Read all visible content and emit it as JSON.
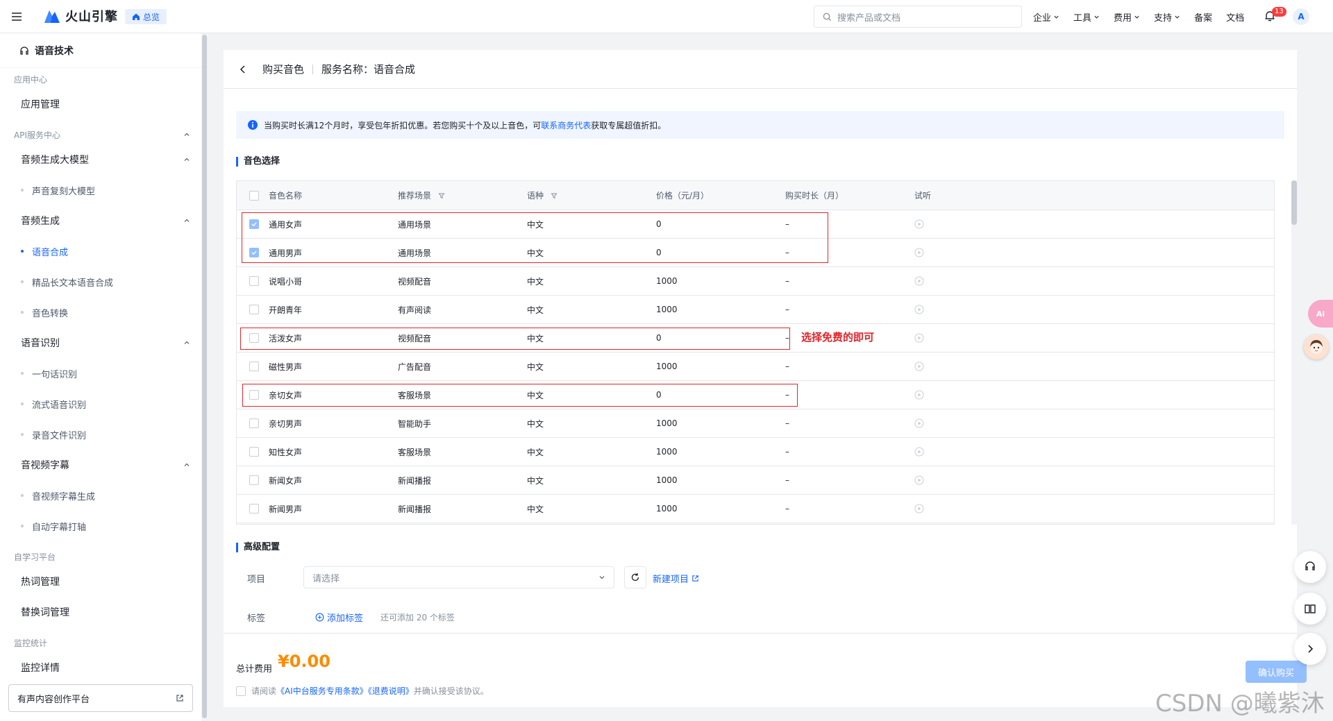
{
  "topbar": {
    "brand": "火山引擎",
    "overview": "总览",
    "search_placeholder": "搜索产品或文档",
    "nav": [
      "企业",
      "工具",
      "费用",
      "支持",
      "备案",
      "文档"
    ],
    "notification_count": "13",
    "avatar_letter": "A"
  },
  "sidebar": {
    "title": "语音技术",
    "items": [
      {
        "kind": "group",
        "label": "应用中心"
      },
      {
        "kind": "sub",
        "label": "应用管理"
      },
      {
        "kind": "group",
        "label": "API服务中心"
      },
      {
        "kind": "sub",
        "label": "音频生成大模型"
      },
      {
        "kind": "leaf",
        "label": "声音复刻大模型"
      },
      {
        "kind": "sub",
        "label": "音频生成"
      },
      {
        "kind": "leaf",
        "label": "语音合成",
        "active": true
      },
      {
        "kind": "leaf",
        "label": "精品长文本语音合成"
      },
      {
        "kind": "leaf",
        "label": "音色转换"
      },
      {
        "kind": "sub",
        "label": "语音识别"
      },
      {
        "kind": "leaf",
        "label": "一句话识别"
      },
      {
        "kind": "leaf",
        "label": "流式语音识别"
      },
      {
        "kind": "leaf",
        "label": "录音文件识别"
      },
      {
        "kind": "sub",
        "label": "音视频字幕"
      },
      {
        "kind": "leaf",
        "label": "音视频字幕生成"
      },
      {
        "kind": "leaf",
        "label": "自动字幕打轴"
      },
      {
        "kind": "group",
        "label": "自学习平台"
      },
      {
        "kind": "sub",
        "label": "热词管理"
      },
      {
        "kind": "sub",
        "label": "替换词管理"
      },
      {
        "kind": "group",
        "label": "监控统计"
      },
      {
        "kind": "sub",
        "label": "监控详情"
      }
    ],
    "bottom_link": "有声内容创作平台"
  },
  "page": {
    "title": "购买音色",
    "service_label": "服务名称：语音合成",
    "notice_prefix": "当购买时长满12个月时，享受包年折扣优惠。若您购买十个及以上音色，可",
    "notice_link": "联系商务代表",
    "notice_suffix": "获取专属超值折扣。",
    "section_voice": "音色选择",
    "section_advanced": "高级配置"
  },
  "table": {
    "headers": [
      "音色名称",
      "推荐场景",
      "语种",
      "价格（元/月）",
      "购买时长（月）",
      "试听"
    ],
    "rows": [
      {
        "name": "通用女声",
        "scene": "通用场景",
        "lang": "中文",
        "price": "0",
        "duration": "–",
        "checked": true
      },
      {
        "name": "通用男声",
        "scene": "通用场景",
        "lang": "中文",
        "price": "0",
        "duration": "–",
        "checked": true
      },
      {
        "name": "说唱小哥",
        "scene": "视频配音",
        "lang": "中文",
        "price": "1000",
        "duration": "–",
        "checked": false
      },
      {
        "name": "开朗青年",
        "scene": "有声阅读",
        "lang": "中文",
        "price": "1000",
        "duration": "–",
        "checked": false
      },
      {
        "name": "活泼女声",
        "scene": "视频配音",
        "lang": "中文",
        "price": "0",
        "duration": "–",
        "checked": false
      },
      {
        "name": "磁性男声",
        "scene": "广告配音",
        "lang": "中文",
        "price": "1000",
        "duration": "–",
        "checked": false
      },
      {
        "name": "亲切女声",
        "scene": "客服场景",
        "lang": "中文",
        "price": "0",
        "duration": "–",
        "checked": false
      },
      {
        "name": "亲切男声",
        "scene": "智能助手",
        "lang": "中文",
        "price": "1000",
        "duration": "–",
        "checked": false
      },
      {
        "name": "知性女声",
        "scene": "客服场景",
        "lang": "中文",
        "price": "1000",
        "duration": "–",
        "checked": false
      },
      {
        "name": "新闻女声",
        "scene": "新闻播报",
        "lang": "中文",
        "price": "1000",
        "duration": "–",
        "checked": false
      },
      {
        "name": "新闻男声",
        "scene": "新闻播报",
        "lang": "中文",
        "price": "1000",
        "duration": "–",
        "checked": false
      }
    ]
  },
  "annotation": "选择免费的即可",
  "advanced": {
    "project_label": "项目",
    "project_placeholder": "请选择",
    "new_project": "新建项目",
    "tag_label": "标签",
    "add_tag": "添加标签",
    "tag_hint": "还可添加 20 个标签"
  },
  "footer": {
    "total_label": "总计费用",
    "total_price": "¥0.00",
    "agree_prefix": "请阅读",
    "agree_link1": "《AI中台服务专用条款》",
    "agree_link2": "《退费说明》",
    "agree_suffix": "并确认接受该协议。",
    "buy_button": "确认购买"
  },
  "floating": {
    "pink_tab": "Ai"
  },
  "watermark": "CSDN @曦紫沐",
  "colors": {
    "accent": "#1664ff",
    "annotation": "#e0242a",
    "price": "#ff8a00"
  }
}
